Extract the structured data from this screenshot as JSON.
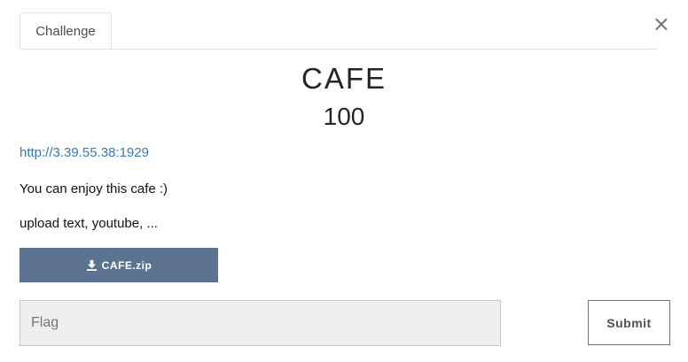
{
  "tabs": [
    {
      "label": "Challenge"
    }
  ],
  "close_glyph": "×",
  "challenge": {
    "name": "CAFE",
    "points": "100",
    "link": "http://3.39.55.38:1929",
    "description": [
      "You can enjoy this cafe :)",
      "upload text, youtube, ..."
    ],
    "file": {
      "label": "CAFE.zip",
      "icon": "download-icon"
    }
  },
  "form": {
    "flag_placeholder": "Flag",
    "submit_label": "Submit"
  },
  "colors": {
    "download_button": "#5b7391",
    "link": "#337ab7"
  }
}
